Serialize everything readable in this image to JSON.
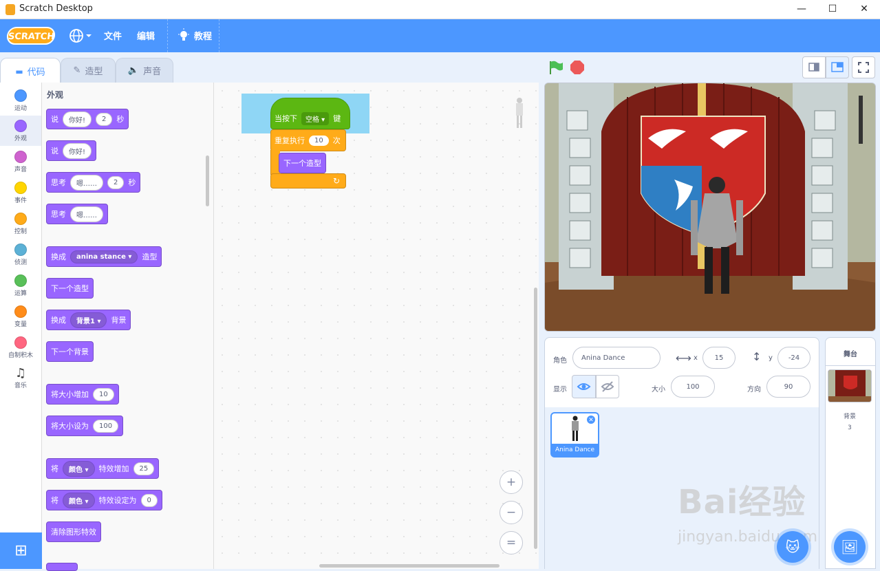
{
  "window": {
    "title": "Scratch Desktop",
    "min": "—",
    "max": "☐",
    "close": "✕"
  },
  "menu": {
    "logo": "SCRATCH",
    "language_icon": "globe-icon",
    "file": "文件",
    "edit": "编辑",
    "tutorials": "教程"
  },
  "tabs": {
    "code": "代码",
    "costumes": "造型",
    "sounds": "声音"
  },
  "categories": [
    {
      "label": "运动",
      "color": "#4c97ff"
    },
    {
      "label": "外观",
      "color": "#9966ff"
    },
    {
      "label": "声音",
      "color": "#cf63cf"
    },
    {
      "label": "事件",
      "color": "#ffd500"
    },
    {
      "label": "控制",
      "color": "#ffab19"
    },
    {
      "label": "侦测",
      "color": "#5cb1d6"
    },
    {
      "label": "运算",
      "color": "#59c059"
    },
    {
      "label": "变量",
      "color": "#ff8c1a"
    },
    {
      "label": "自制积木",
      "color": "#ff6680"
    },
    {
      "label": "音乐",
      "color": ""
    }
  ],
  "palette": {
    "title": "外观",
    "say_secs": {
      "a": "说",
      "msg": "你好!",
      "secs": "2",
      "b": "秒"
    },
    "say": {
      "a": "说",
      "msg": "你好!"
    },
    "think_secs": {
      "a": "思考",
      "msg": "嗯……",
      "secs": "2",
      "b": "秒"
    },
    "think": {
      "a": "思考",
      "msg": "嗯……"
    },
    "switch_costume": {
      "a": "换成",
      "val": "anina stance",
      "b": "造型"
    },
    "next_costume": "下一个造型",
    "switch_backdrop": {
      "a": "换成",
      "val": "背景1",
      "b": "背景"
    },
    "next_backdrop": "下一个背景",
    "change_size": {
      "a": "将大小增加",
      "val": "10"
    },
    "set_size": {
      "a": "将大小设为",
      "val": "100"
    },
    "change_effect": {
      "a": "将",
      "effect": "颜色",
      "b": "特效增加",
      "val": "25"
    },
    "set_effect": {
      "a": "将",
      "effect": "颜色",
      "b": "特效设定为",
      "val": "0"
    },
    "clear_effects": "清除图形特效"
  },
  "script": {
    "when_key": {
      "a": "当按下",
      "key": "空格",
      "b": "键"
    },
    "repeat": {
      "a": "重复执行",
      "times": "10",
      "b": "次"
    },
    "next_costume": "下一个造型"
  },
  "zoom": {
    "in": "+",
    "out": "−",
    "reset": "="
  },
  "sprite": {
    "label_sprite": "角色",
    "name": "Anina Dance",
    "label_x": "x",
    "x": "15",
    "label_y": "y",
    "y": "-24",
    "label_show": "显示",
    "label_size": "大小",
    "size": "100",
    "label_direction": "方向",
    "direction": "90",
    "tile_name": "Anina Dance"
  },
  "stage_pane": {
    "title": "舞台",
    "backdrops_label": "背景",
    "backdrops_count": "3"
  },
  "watermark": {
    "line1": "Bai经验",
    "line2": "jingyan.baidu.com"
  }
}
